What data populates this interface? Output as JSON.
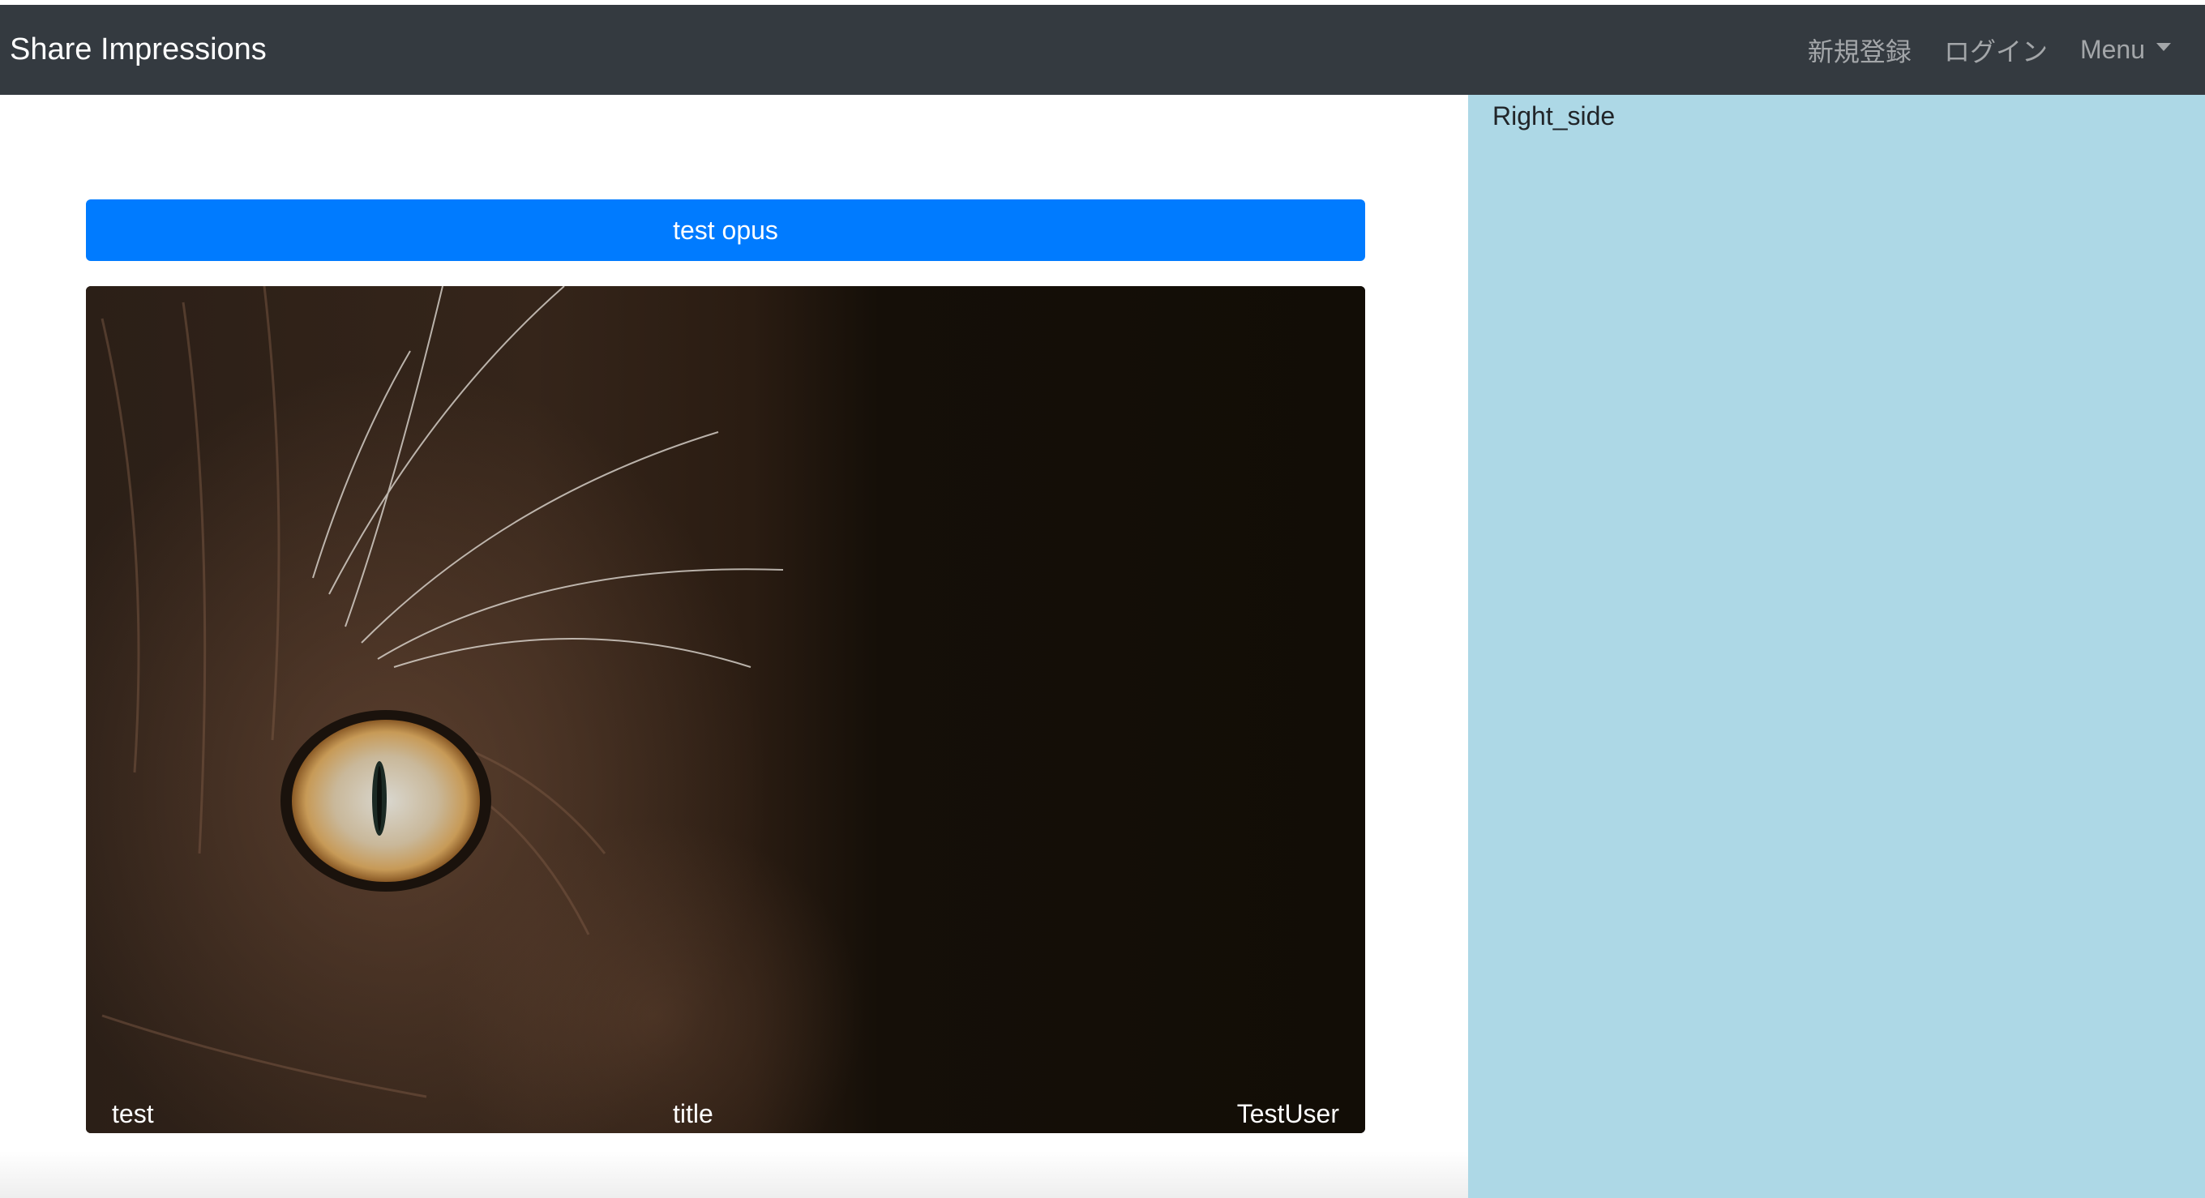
{
  "navbar": {
    "brand": "Share Impressions",
    "links": [
      {
        "label": "新規登録"
      },
      {
        "label": "ログイン"
      },
      {
        "label": "Menu"
      }
    ]
  },
  "right_side": {
    "label": "Right_side",
    "background": "#add8e6"
  },
  "opus_button": {
    "label": "test opus",
    "color": "#007bff"
  },
  "card": {
    "image": "black-cat-eye-closeup",
    "caption_left": "test",
    "caption_center": "title",
    "caption_right": "TestUser"
  }
}
